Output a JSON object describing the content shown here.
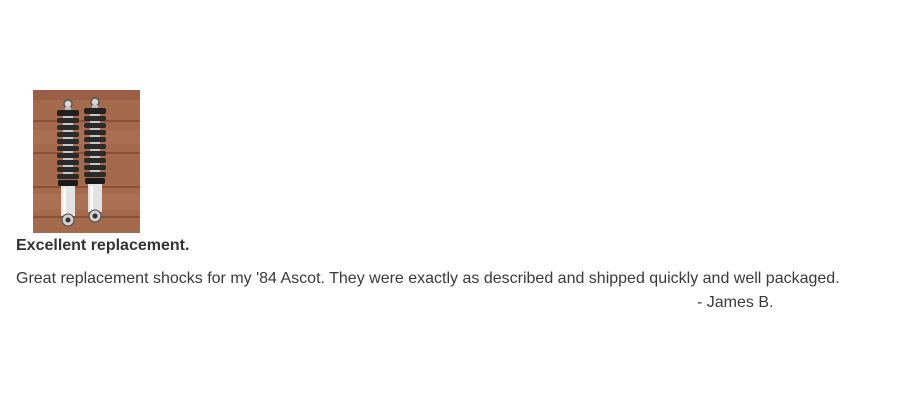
{
  "review": {
    "image_alt": "Pair of chrome rear shocks with black springs on a wooden surface",
    "title": "Excellent replacement.",
    "body": "Great replacement shocks for my '84 Ascot. They were exactly as described and shipped quickly and well packaged.",
    "author": "- James B."
  },
  "colors": {
    "text": "#333333",
    "background": "#ffffff",
    "wood": "#a0664a"
  }
}
